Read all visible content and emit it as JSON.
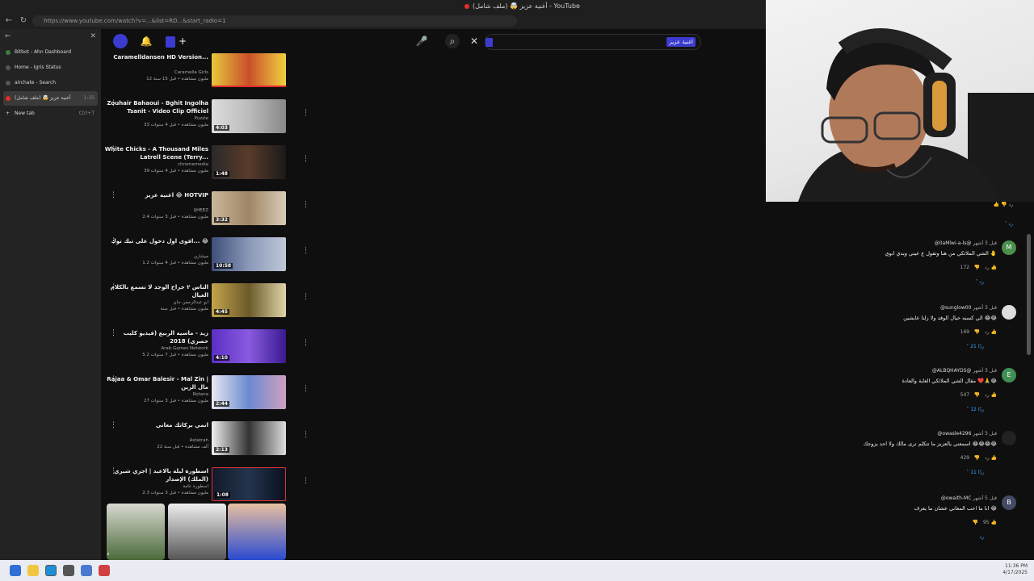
{
  "browser": {
    "window_title": "أغنية عزيز 🤯 (ملف شامل) - YouTube",
    "url": "https://www.youtube.com/watch?v=...&list=RD...&start_radio=1"
  },
  "sidepanel": {
    "tabs": [
      {
        "label": "Bitbot - Ahn Dashboard",
        "meta": ""
      },
      {
        "label": "Home - Igris Status",
        "meta": ""
      },
      {
        "label": "airchate - Search",
        "meta": ""
      },
      {
        "label": "أغنية عزيز 🤯 (ملف شامل)",
        "meta": "1:35"
      },
      {
        "label": "New tab",
        "meta": "Ctrl+T"
      }
    ]
  },
  "videos": [
    {
      "title": "Caramelldansen HD Version...",
      "channel": "Caramella Girls",
      "meta": "12 مليون مشاهدة • قبل 15 سنة",
      "duration": ""
    },
    {
      "title": "Zouhair Bahaoui - Bghit Ingolha Tsanit - Video Clip Officiel",
      "channel": "Puzzle",
      "meta": "33 مليون مشاهدة • قبل 4 سنوات",
      "duration": "4:03"
    },
    {
      "title": "White Chicks - A Thousand Miles Latrell Scene (Terry...",
      "channel": "chromemedia",
      "meta": "39 مليون مشاهدة • قبل 4 سنوات",
      "duration": "1:48"
    },
    {
      "title": "اغنية عزيز 😂 HOTVIP",
      "channel": "IJHEEZ",
      "meta": "2.4 مليون مشاهدة • قبل 3 سنوات",
      "duration": "3:32"
    },
    {
      "title": "اقوى اول دخول على تيك توك... 😂",
      "channel": "ميشاري",
      "meta": "1.2 مليون مشاهدة • قبل 4 سنوات",
      "duration": "10:58"
    },
    {
      "title": "الناس ٢ جراح الوجد لا تسمع بالكلام العيال",
      "channel": "ابو عبدالرحمن جاي",
      "meta": "مليون مشاهدة • قبل سنة",
      "duration": "4:45"
    },
    {
      "title": "زيد - ماسية الربيع (فيديو كليب حصري) 2018",
      "channel": "Arab Games Network",
      "meta": "5.2 مليون مشاهدة • قبل 7 سنوات",
      "duration": "4:10"
    },
    {
      "title": "Rajaa & Omar Balesir - Mal Zin | مال الزين",
      "channel": "Rotana",
      "meta": "27 مليون مشاهدة • قبل 3 سنوات",
      "duration": "2:44"
    },
    {
      "title": "انمي بركاتك معاني",
      "channel": "Astatrah",
      "meta": "22 ألف مشاهدة • قبل سنة",
      "duration": "2:13"
    },
    {
      "title": "اسطورة ليلة بالاعيد | اجري شيري (الملك) الإصدار",
      "channel": "اسطورة عامة",
      "meta": "2.3 مليون مشاهدة • قبل 3 سنوات",
      "duration": "1:08"
    }
  ],
  "comments": [
    {
      "user": "@0aMlwi-a-ls@",
      "time": "قبل 3 أشهر",
      "text": "الشي الملائكي من هنا وتقول ع عيني وبدي ابوي  🤚",
      "likes": "172",
      "replies": "رد",
      "avatar_color": "#4a8f4a",
      "avatar_letter": "M"
    },
    {
      "user": "@sunglow00",
      "time": "قبل 3 أشهر",
      "text": "الي كسبه خيال الوقد ولا زلنا عايشين 😂😂",
      "likes": "169",
      "replies": "21 ردًا",
      "avatar_color": "#dddddd",
      "avatar_letter": ""
    },
    {
      "user": "@ALBQHAYDS@",
      "time": "قبل 3 أشهر",
      "text": "مقال الشي الملائكي الغاية والعادة  ❤️🙏😂",
      "likes": "547",
      "replies": "12 ردًا",
      "avatar_color": "#3f8f55",
      "avatar_letter": "E"
    },
    {
      "user": "@owasle4296",
      "time": "قبل 3 أشهر",
      "text": "اسمعني يالعزيز ما تتكلم ترى مالك ولا احد يزوجك 😂😂😂😂",
      "likes": "429",
      "replies": "11 ردًا",
      "avatar_color": "#222222",
      "avatar_letter": ""
    },
    {
      "user": "@owaith-MC",
      "time": "قبل 5 أشهر",
      "text": "انا ما احب المعاني عشان ما يعرف 😂",
      "likes": "95",
      "replies": "رد",
      "avatar_color": "#444a66",
      "avatar_letter": "B"
    }
  ],
  "taskbar": {
    "time": "11:36 PM",
    "date": "4/17/2025"
  }
}
